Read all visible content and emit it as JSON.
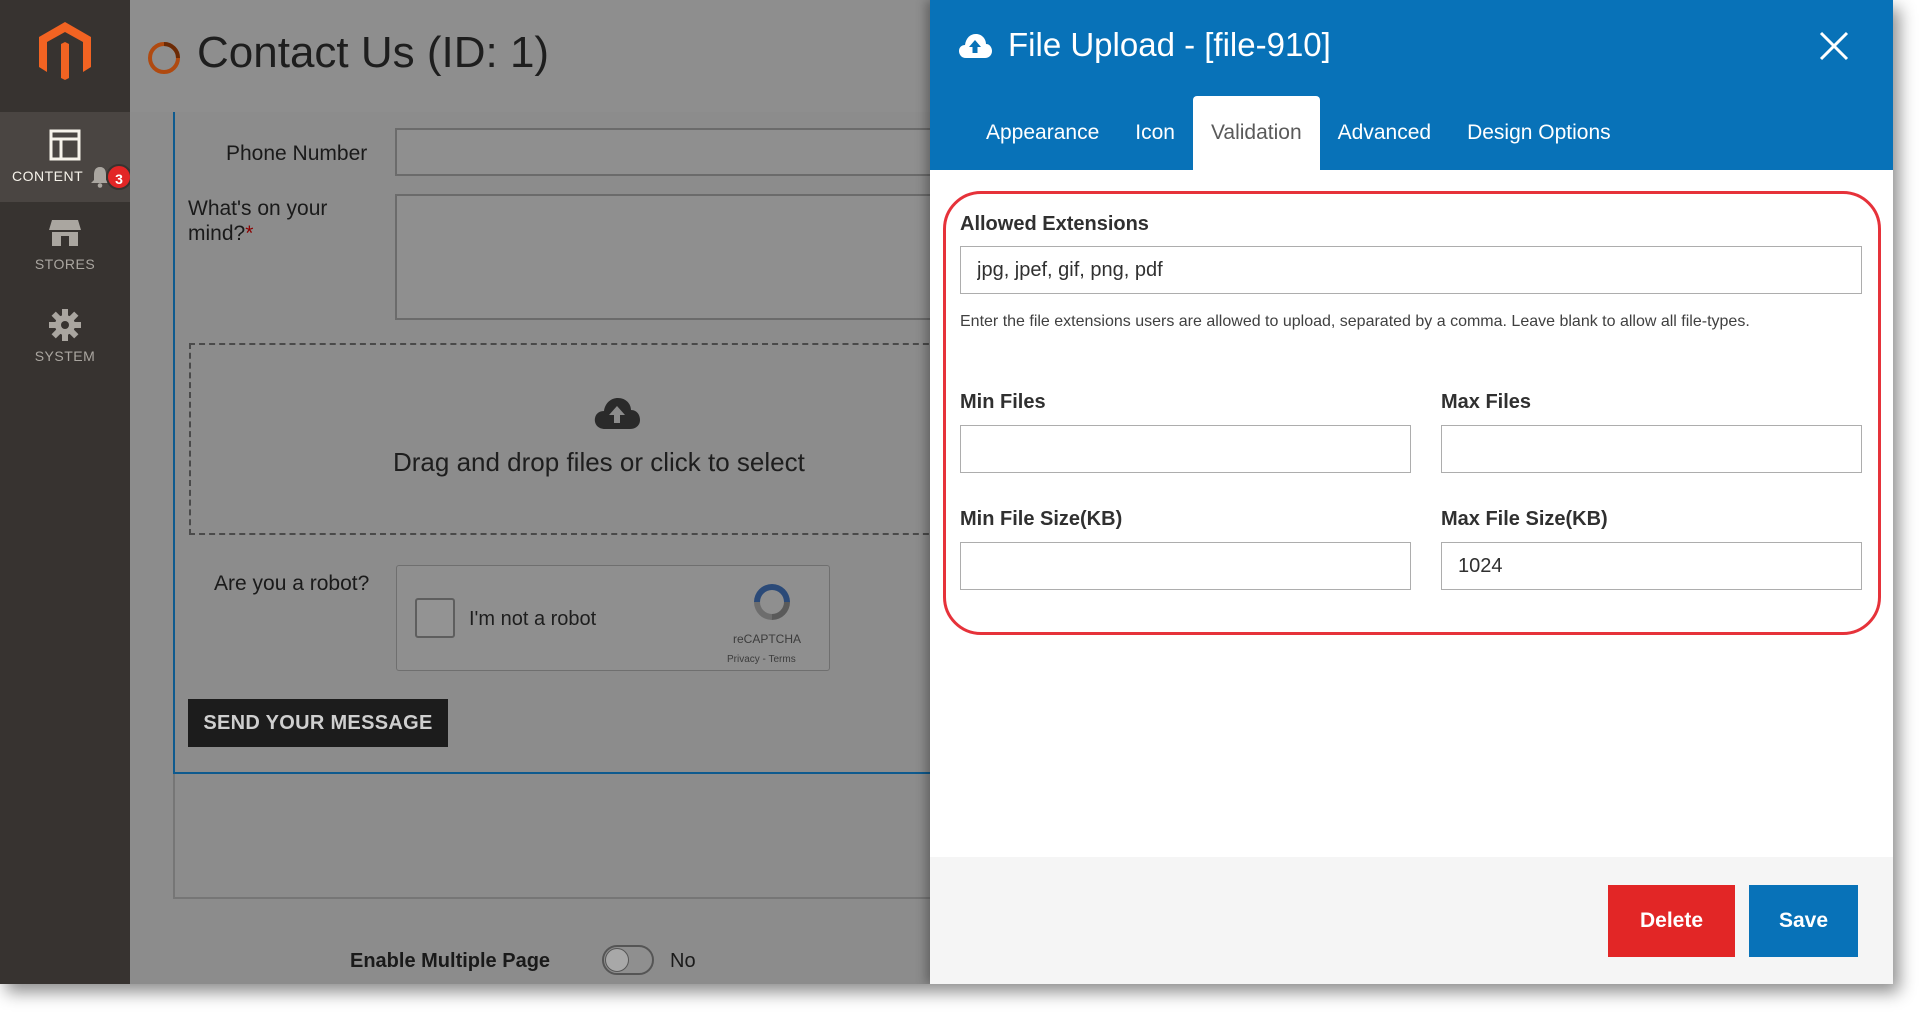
{
  "colors": {
    "admin_menu_bg": "#373330",
    "modal_header_bg": "#0872b8",
    "validation_outline": "#e6323a",
    "delete_button": "#e22626",
    "save_button": "#0872b8"
  },
  "admin_menu": {
    "logo_icon": "magento-logo-icon",
    "items": [
      {
        "label": "CONTENT",
        "icon": "layout-icon",
        "active": true
      },
      {
        "label": "STORES",
        "icon": "store-icon",
        "active": false
      },
      {
        "label": "SYSTEM",
        "icon": "gear-icon",
        "active": false
      }
    ],
    "notification_count": "3"
  },
  "page": {
    "title": "Contact Us (ID: 1)",
    "form": {
      "phone_label": "Phone Number",
      "mind_label": "What's on your mind?",
      "required_mark": "*",
      "dropzone_text": "Drag and drop files or click to select",
      "robot_label": "Are you a robot?",
      "recaptcha_text": "I'm not a robot",
      "recaptcha_brand": "reCAPTCHA",
      "recaptcha_links": "Privacy - Terms",
      "send_button": "SEND YOUR MESSAGE"
    },
    "multi_page": {
      "label": "Enable Multiple Page",
      "value": "No"
    }
  },
  "modal": {
    "title": "File Upload - [file-910]",
    "tabs": [
      {
        "label": "Appearance",
        "active": false
      },
      {
        "label": "Icon",
        "active": false
      },
      {
        "label": "Validation",
        "active": true
      },
      {
        "label": "Advanced",
        "active": false
      },
      {
        "label": "Design Options",
        "active": false
      }
    ],
    "validation": {
      "allowed_extensions_label": "Allowed Extensions",
      "allowed_extensions_value": "jpg, jpef, gif, png, pdf",
      "allowed_extensions_note": "Enter the file extensions users are allowed to upload, separated by a comma. Leave blank to allow all file-types.",
      "min_files_label": "Min Files",
      "min_files_value": "",
      "max_files_label": "Max Files",
      "max_files_value": "",
      "min_file_size_label": "Min File Size(KB)",
      "min_file_size_value": "",
      "max_file_size_label": "Max File Size(KB)",
      "max_file_size_value": "1024"
    },
    "footer": {
      "delete_button": "Delete",
      "save_button": "Save"
    }
  }
}
